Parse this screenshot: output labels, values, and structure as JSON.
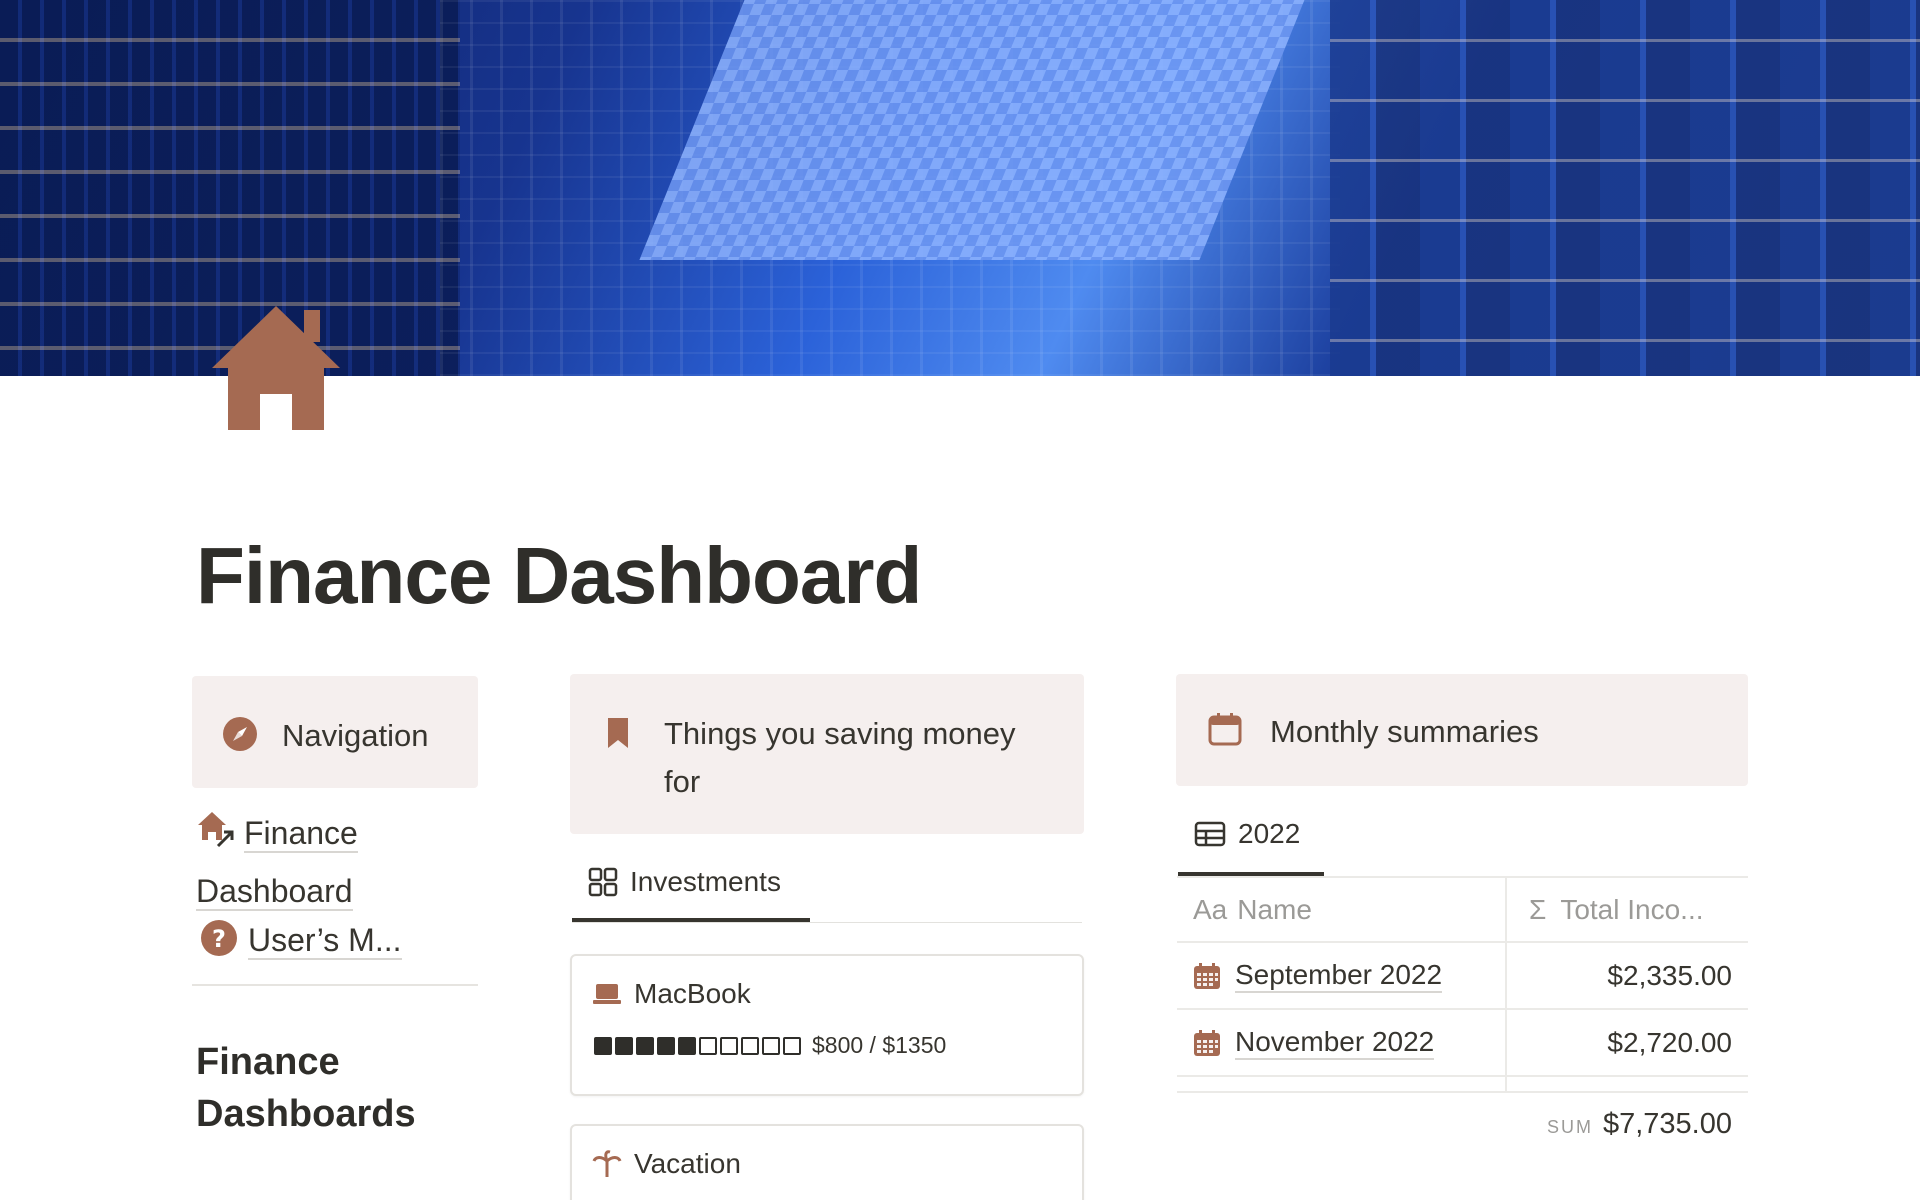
{
  "page": {
    "title": "Finance Dashboard",
    "icon": "house-icon",
    "cover": "city-skyscrapers-cover-image"
  },
  "colors": {
    "accent": "#a56a52",
    "callout_bg": "#f5efee",
    "text": "#37352f",
    "muted": "#9b9a97"
  },
  "navigation": {
    "heading": "Navigation",
    "icon": "compass-icon",
    "links": [
      {
        "label": "Finance",
        "label_line2": "Dashboard",
        "icon": "house-arrow-icon"
      },
      {
        "label": "User’s M...",
        "icon": "question-circle-icon"
      }
    ],
    "subheading": "Finance Dashboards"
  },
  "savings": {
    "heading_line1": "Things you saving money",
    "heading_line2": "for",
    "icon": "bookmark-icon",
    "tab": {
      "label": "Investments",
      "icon": "gallery-icon"
    },
    "cards": [
      {
        "title": "MacBook",
        "icon": "laptop-icon",
        "progress_text": "$800 / $1350",
        "progress_fraction": 0.5926,
        "progress_blocks_total": 10,
        "progress_blocks_filled": 5
      },
      {
        "title": "Vacation",
        "icon": "palm-icon"
      }
    ]
  },
  "monthly": {
    "heading": "Monthly summaries",
    "icon": "calendar-icon",
    "tab": {
      "label": "2022",
      "icon": "table-icon"
    },
    "columns": [
      {
        "label": "Name",
        "prefix": "Aa"
      },
      {
        "label": "Total Inco...",
        "prefix": "Σ"
      }
    ],
    "rows": [
      {
        "name": "September 2022",
        "total": "$2,335.00",
        "icon": "calendar-grid-icon"
      },
      {
        "name": "November 2022",
        "total": "$2,720.00",
        "icon": "calendar-grid-icon"
      }
    ],
    "sum_label": "SUM",
    "sum_value": "$7,735.00"
  }
}
